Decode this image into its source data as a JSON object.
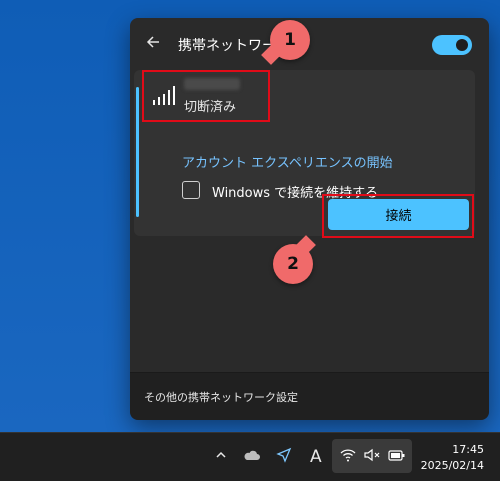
{
  "panel": {
    "title": "携帯ネットワーク",
    "network": {
      "status": "切断済み"
    },
    "link": "アカウント エクスペリエンスの開始",
    "checkbox_label": "Windows で接続を維持する",
    "connect_label": "接続",
    "footer": "その他の携帯ネットワーク設定",
    "toggle_on": true
  },
  "annotations": {
    "badge1": "1",
    "badge2": "2"
  },
  "taskbar": {
    "time": "17:45",
    "date": "2025/02/14",
    "icons": [
      "chevron-up-icon",
      "cloud-icon",
      "location-icon",
      "ime-icon",
      "wifi-icon",
      "speaker-muted-icon",
      "battery-icon"
    ],
    "ime_label": "A"
  },
  "colors": {
    "accent": "#4cc2ff",
    "annotation": "#f06a6a",
    "highlight": "#e10b18"
  }
}
